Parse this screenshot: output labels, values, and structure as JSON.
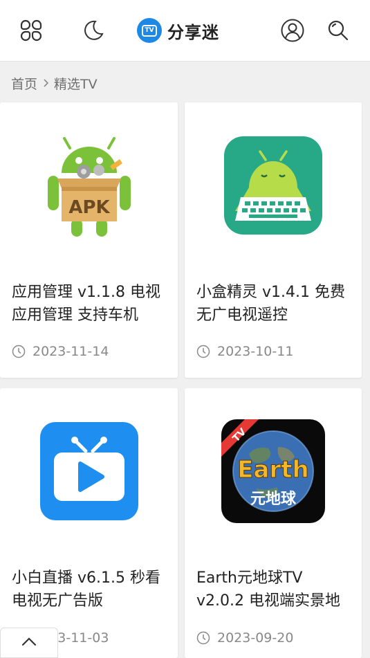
{
  "header": {
    "logo_badge": "TV",
    "logo_text": "分享迷",
    "brand_color": "#1e88e5",
    "icons": [
      "apps-icon",
      "moon-icon",
      "user-icon",
      "search-icon"
    ]
  },
  "breadcrumb": {
    "home": "首页",
    "current": "精选TV"
  },
  "cards": [
    {
      "title": "应用管理 v1.1.8 电视应用管理 支持车机",
      "date": "2023-11-14",
      "icon": "apk-android-icon"
    },
    {
      "title": "小盒精灵 v1.4.1 免费无广电视遥控",
      "date": "2023-10-11",
      "icon": "android-keyboard-icon"
    },
    {
      "title": "小白直播 v6.1.5 秒看电视无广告版",
      "date": "2023-11-03",
      "icon": "tv-play-icon"
    },
    {
      "title": "Earth元地球TV v2.0.2 电视端实景地",
      "date": "2023-09-20",
      "icon": "earth-app-icon"
    }
  ],
  "earth_icon": {
    "word": "Earth",
    "sub": "元地球",
    "ribbon": "TV"
  },
  "apk_icon": {
    "label": "APK"
  }
}
